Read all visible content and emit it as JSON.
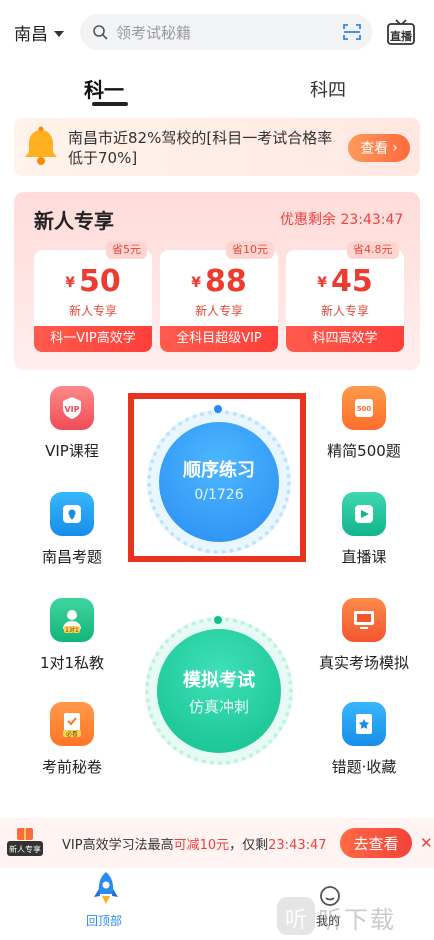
{
  "header": {
    "city": "南昌",
    "search_placeholder": "领考试秘籍",
    "live_label": "直播"
  },
  "tabs": [
    {
      "label": "科一",
      "active": true
    },
    {
      "label": "科四",
      "active": false
    }
  ],
  "notice": {
    "text": "南昌市近82%驾校的[科目一考试合格率低于70%]",
    "button": "查看"
  },
  "new_user": {
    "title": "新人专享",
    "timer": "优惠剩余 23:43:47",
    "coupons": [
      {
        "tag": "省5元",
        "currency": "¥",
        "price": "50",
        "sub": "新人专享",
        "name": "科一VIP高效学"
      },
      {
        "tag": "省10元",
        "currency": "¥",
        "price": "88",
        "sub": "新人专享",
        "name": "全科目超级VIP"
      },
      {
        "tag": "省4.8元",
        "currency": "¥",
        "price": "45",
        "sub": "新人专享",
        "name": "科四高效学"
      }
    ]
  },
  "grid": {
    "vip": "VIP课程",
    "five_hundred": "精简500题",
    "five_hundred_icon_text": "500",
    "local": "南昌考题",
    "live": "直播课",
    "tutor": "1对1私教",
    "tutor_icon_text": "1对1",
    "real_exam": "真实考场模拟",
    "pre_exam": "考前秘卷",
    "pre_exam_icon_text": "必看",
    "wrong": "错题·收藏"
  },
  "sequence": {
    "title": "顺序练习",
    "count": "0/1726"
  },
  "mock": {
    "title": "模拟考试",
    "subtitle": "仿真冲刺"
  },
  "promo": {
    "badge": "新人专享",
    "text_a": "VIP高效学习法最高",
    "text_red": "可减10元",
    "text_b": "，仅剩",
    "timer": "23:43:47",
    "button": "去查看",
    "close": "✕"
  },
  "tabbar": {
    "home": "回顶部",
    "mine": "我的"
  },
  "watermark": {
    "logo_char": "听",
    "text": "听下载"
  },
  "colors": {
    "accent_blue": "#2a8cf2",
    "accent_green": "#14c08d",
    "accent_red": "#f0413f",
    "highlight_box": "#e8341e"
  }
}
